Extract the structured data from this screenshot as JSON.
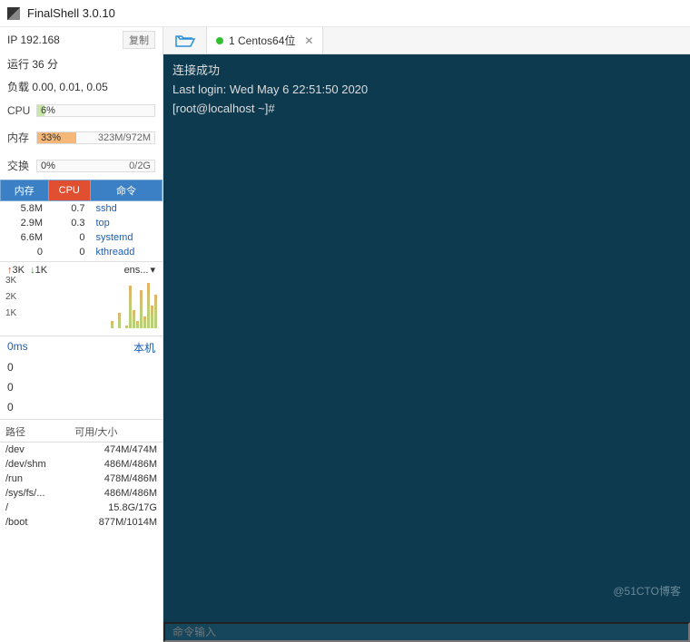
{
  "titlebar": {
    "title": "FinalShell 3.0.10"
  },
  "sidebar": {
    "ip_label": "IP",
    "ip_value": "192.168",
    "copy_btn": "复制",
    "uptime": "运行 36 分",
    "load": "负载 0.00, 0.01, 0.05",
    "cpu": {
      "label": "CPU",
      "pct": "6%",
      "width": "6%"
    },
    "mem": {
      "label": "内存",
      "pct": "33%",
      "detail": "323M/972M",
      "width": "33%"
    },
    "swap": {
      "label": "交换",
      "pct": "0%",
      "detail": "0/2G",
      "width": "0%"
    },
    "proc_headers": {
      "mem": "内存",
      "cpu": "CPU",
      "cmd": "命令"
    },
    "procs": [
      {
        "mem": "5.8M",
        "cpu": "0.7",
        "cmd": "sshd"
      },
      {
        "mem": "2.9M",
        "cpu": "0.3",
        "cmd": "top"
      },
      {
        "mem": "6.6M",
        "cpu": "0",
        "cmd": "systemd"
      },
      {
        "mem": "0",
        "cpu": "0",
        "cmd": "kthreadd"
      }
    ],
    "net": {
      "up": "3K",
      "down": "1K",
      "iface": "ens...",
      "y": [
        "3K",
        "2K",
        "1K"
      ]
    },
    "ping": {
      "ms": "0ms",
      "loc": "本机",
      "vals": [
        "0",
        "0",
        "0"
      ]
    },
    "disk_headers": {
      "path": "路径",
      "size": "可用/大小"
    },
    "disks": [
      {
        "path": "/dev",
        "size": "474M/474M"
      },
      {
        "path": "/dev/shm",
        "size": "486M/486M"
      },
      {
        "path": "/run",
        "size": "478M/486M"
      },
      {
        "path": "/sys/fs/...",
        "size": "486M/486M"
      },
      {
        "path": "/",
        "size": "15.8G/17G"
      },
      {
        "path": "/boot",
        "size": "877M/1014M"
      }
    ]
  },
  "tab": {
    "label": "1 Centos64位"
  },
  "terminal": {
    "line1": "连接成功",
    "line2": "Last login: Wed May  6 22:51:50 2020",
    "line3": "[root@localhost ~]#",
    "watermark": "@51CTO博客",
    "cmd_placeholder": "命令输入"
  },
  "chart_data": {
    "type": "bar",
    "title": "network traffic",
    "ylabel": "",
    "xlabel": "",
    "ylim": [
      0,
      3
    ],
    "y_ticks": [
      "1K",
      "2K",
      "3K"
    ],
    "series": [
      {
        "name": "up",
        "values": [
          0,
          0.5,
          0,
          1,
          0,
          0.2,
          2.8,
          1.2,
          0.5,
          2.5,
          0.8,
          3,
          1.5,
          2.2
        ]
      },
      {
        "name": "down",
        "values": [
          0,
          0.3,
          0,
          0.6,
          0,
          0.1,
          1.8,
          0.8,
          0.3,
          1.6,
          0.5,
          2,
          1,
          1.4
        ]
      }
    ]
  }
}
